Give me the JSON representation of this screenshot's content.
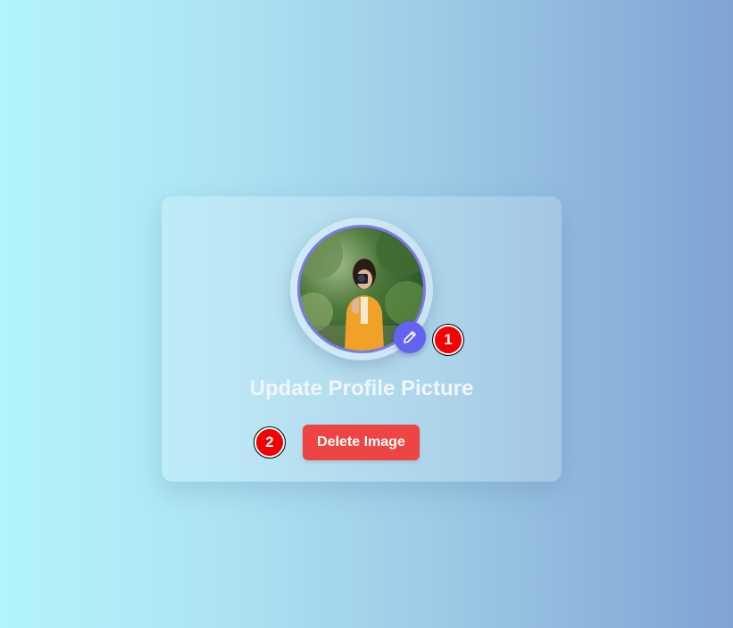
{
  "profile": {
    "title": "Update Profile Picture",
    "avatar_icon": "profile-photo",
    "edit_icon": "pencil-icon",
    "delete_label": "Delete Image"
  },
  "badges": {
    "first": "1",
    "second": "2"
  },
  "colors": {
    "accent": "#6363f1",
    "danger": "#ef4444",
    "badge": "#f40000"
  }
}
